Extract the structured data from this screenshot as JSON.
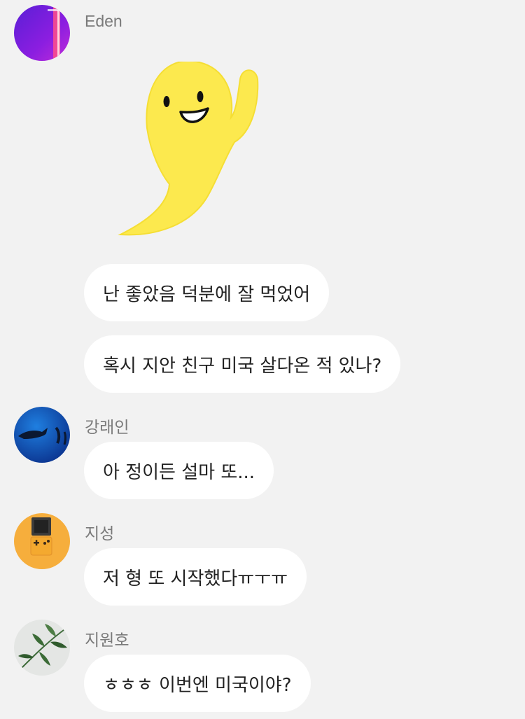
{
  "messages": [
    {
      "sender": "Eden",
      "sticker": "yellow-ghost-waving",
      "bubbles": [
        "난 좋았음 덕분에 잘 먹었어",
        "혹시 지안 친구 미국 살다온 적 있나?"
      ]
    },
    {
      "sender": "강래인",
      "bubbles": [
        "아 정이든 설마 또..."
      ]
    },
    {
      "sender": "지성",
      "bubbles": [
        "저 형 또 시작했다ㅠㅜㅠ"
      ]
    },
    {
      "sender": "지원호",
      "bubbles": [
        "ㅎㅎㅎ 이번엔 미국이야?"
      ]
    }
  ],
  "colors": {
    "background": "#f2f2f2",
    "bubble": "#ffffff",
    "sticker_body": "#fce94e"
  }
}
